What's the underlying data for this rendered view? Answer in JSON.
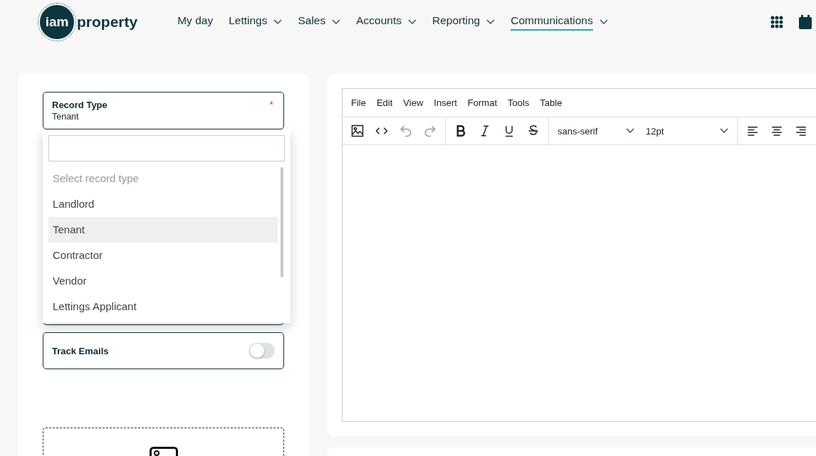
{
  "logo": {
    "badge": "iam",
    "name": "property"
  },
  "nav": [
    {
      "label": "My day",
      "has_menu": false,
      "selected": false
    },
    {
      "label": "Lettings",
      "has_menu": true,
      "selected": false
    },
    {
      "label": "Sales",
      "has_menu": true,
      "selected": false
    },
    {
      "label": "Accounts",
      "has_menu": true,
      "selected": false
    },
    {
      "label": "Reporting",
      "has_menu": true,
      "selected": false
    },
    {
      "label": "Communications",
      "has_menu": true,
      "selected": true
    }
  ],
  "record_type": {
    "label": "Record Type",
    "required_mark": "*",
    "value": "Tenant",
    "dropdown": {
      "options": [
        {
          "label": "Select record type",
          "kind": "placeholder",
          "selected": false
        },
        {
          "label": "Landlord",
          "kind": "option",
          "selected": false
        },
        {
          "label": "Tenant",
          "kind": "option",
          "selected": true
        },
        {
          "label": "Contractor",
          "kind": "option",
          "selected": false
        },
        {
          "label": "Vendor",
          "kind": "option",
          "selected": false
        },
        {
          "label": "Lettings Applicant",
          "kind": "option",
          "selected": false
        }
      ]
    }
  },
  "track_emails": {
    "label": "Track Emails",
    "on": false
  },
  "editor": {
    "menu": [
      "File",
      "Edit",
      "View",
      "Insert",
      "Format",
      "Tools",
      "Table"
    ],
    "tools": [
      {
        "kind": "image",
        "disabled": false
      },
      {
        "kind": "code",
        "disabled": false
      },
      {
        "kind": "undo",
        "disabled": true
      },
      {
        "kind": "redo",
        "disabled": true
      },
      {
        "kind": "bold",
        "disabled": false
      },
      {
        "kind": "italic",
        "disabled": false
      },
      {
        "kind": "underline",
        "disabled": false
      },
      {
        "kind": "strike",
        "disabled": false
      }
    ],
    "font": "sans-serif",
    "size": "12pt",
    "align": [
      {
        "kind": "left"
      },
      {
        "kind": "center"
      },
      {
        "kind": "right"
      }
    ]
  }
}
